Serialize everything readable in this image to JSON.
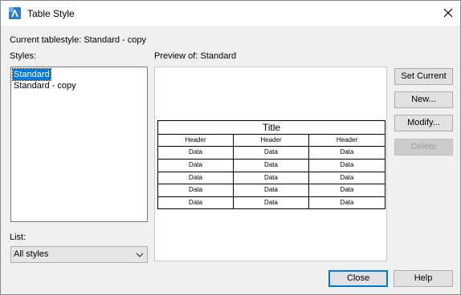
{
  "window": {
    "title": "Table Style"
  },
  "header": {
    "current_label": "Current tablestyle:",
    "current_value": "Standard - copy"
  },
  "styles": {
    "label": "Styles:",
    "items": [
      {
        "label": "Standard",
        "selected": true
      },
      {
        "label": "Standard - copy",
        "selected": false
      }
    ]
  },
  "list": {
    "label": "List:",
    "selected": "All styles"
  },
  "preview": {
    "label_prefix": "Preview of:",
    "style_name": "Standard",
    "table": {
      "title": "Title",
      "headers": [
        "Header",
        "Header",
        "Header"
      ],
      "rows": [
        [
          "Data",
          "Data",
          "Data"
        ],
        [
          "Data",
          "Data",
          "Data"
        ],
        [
          "Data",
          "Data",
          "Data"
        ],
        [
          "Data",
          "Data",
          "Data"
        ],
        [
          "Data",
          "Data",
          "Data"
        ]
      ]
    }
  },
  "buttons": {
    "set_current": "Set Current",
    "new": "New...",
    "modify": "Modify...",
    "delete": "Delete",
    "close": "Close",
    "help": "Help"
  },
  "icons": {
    "app": "autocad-app-icon",
    "close": "close-icon",
    "dropdown": "chevron-down-icon"
  },
  "colors": {
    "selection": "#0078d7",
    "dialog_bg": "#f0f0f0"
  }
}
